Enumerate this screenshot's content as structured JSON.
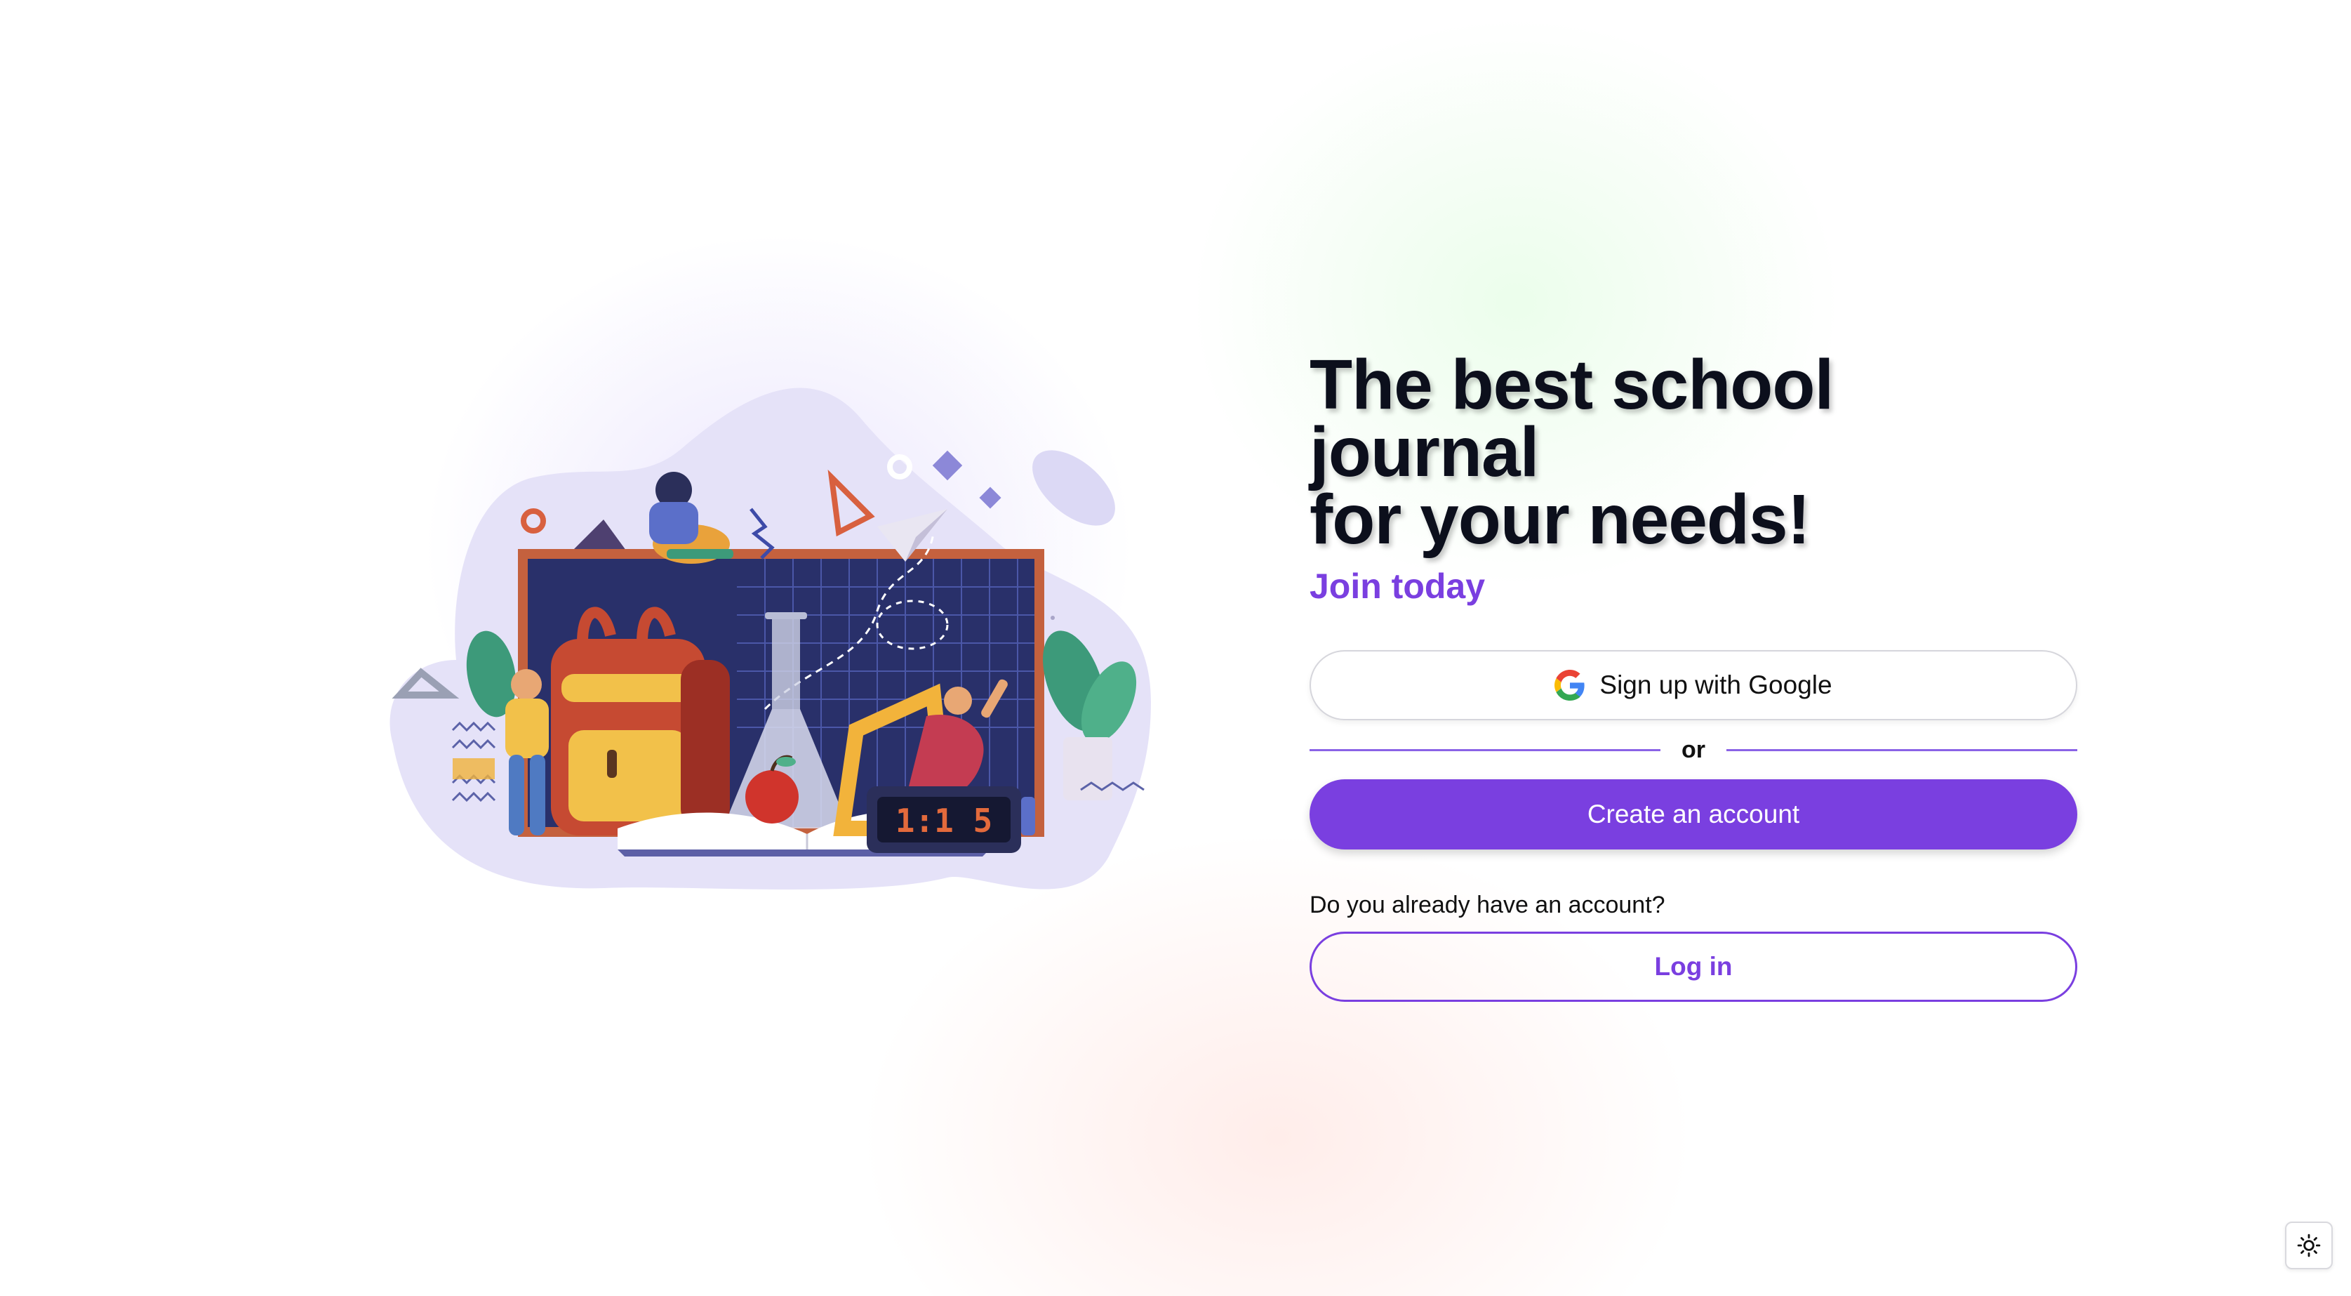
{
  "hero": {
    "title_line1": "The best school journal",
    "title_line2": "for your needs!",
    "subtitle": "Join today"
  },
  "actions": {
    "google_label": "Sign up with Google",
    "divider_label": "or",
    "create_label": "Create an account",
    "existing_question": "Do you already have an account?",
    "login_label": "Log in"
  },
  "illustration": {
    "clock_digits": "1:1 5",
    "icon": "school-supplies-illustration"
  },
  "theme": {
    "icon": "sun-icon"
  },
  "colors": {
    "accent": "#7a3fe0",
    "heading": "#0c0f1c",
    "text": "#111111"
  }
}
